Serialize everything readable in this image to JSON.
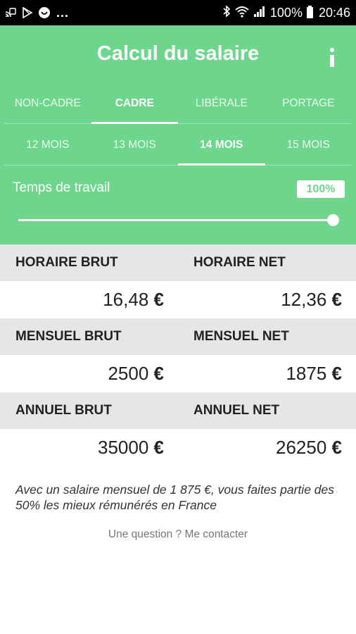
{
  "status_bar": {
    "icons_left": [
      "cast-icon",
      "play-store-icon",
      "app-icon"
    ],
    "more": "...",
    "battery_text": "100%",
    "time": "20:46"
  },
  "header": {
    "title": "Calcul du salaire",
    "category_tabs": [
      {
        "label": "NON-CADRE",
        "active": false
      },
      {
        "label": "CADRE",
        "active": true
      },
      {
        "label": "LIBÉRALE",
        "active": false
      },
      {
        "label": "PORTAGE",
        "active": false
      }
    ],
    "month_tabs": [
      {
        "label": "12 MOIS",
        "active": false
      },
      {
        "label": "13 MOIS",
        "active": false
      },
      {
        "label": "14 MOIS",
        "active": true
      },
      {
        "label": "15 MOIS",
        "active": false
      }
    ],
    "work_time": {
      "label": "Temps de travail",
      "value": "100%",
      "level": 1.0
    }
  },
  "results": {
    "hourly": {
      "gross_label": "HORAIRE BRUT",
      "net_label": "HORAIRE NET",
      "gross_value": "16,48",
      "net_value": "12,36"
    },
    "monthly": {
      "gross_label": "MENSUEL BRUT",
      "net_label": "MENSUEL NET",
      "gross_value": "2500",
      "net_value": "1875"
    },
    "annual": {
      "gross_label": "ANNUEL BRUT",
      "net_label": "ANNUEL NET",
      "gross_value": "35000",
      "net_value": "26250"
    },
    "currency": "€"
  },
  "note": "Avec un salaire mensuel de 1 875 €, vous faites partie des 50% les mieux rémunérés en France",
  "contact": "Une question ? Me contacter",
  "colors": {
    "primary": "#6ed68c",
    "label_bg": "#e6e6e6"
  }
}
